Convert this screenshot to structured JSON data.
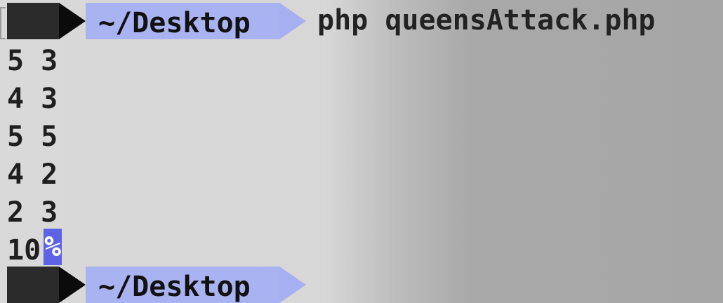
{
  "prompt": {
    "directory": "~/Desktop",
    "command": "php queensAttack.php"
  },
  "output": {
    "lines": [
      "5 3",
      "4 3",
      "5 5",
      "4 2",
      "2 3",
      "10"
    ],
    "end_marker": "%"
  },
  "second_prompt": {
    "directory": "~/Desktop"
  },
  "colors": {
    "prompt_dark": "#2b2b2b",
    "prompt_blue": "#aab3f2",
    "cursor_highlight": "#5e63e6"
  }
}
